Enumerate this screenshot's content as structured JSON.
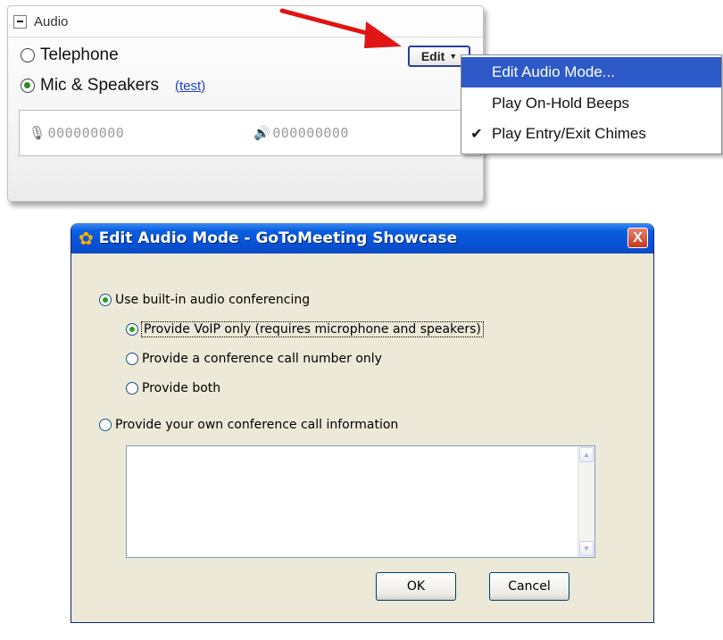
{
  "audio_panel": {
    "title": "Audio",
    "options": [
      {
        "label": "Telephone",
        "selected": false
      },
      {
        "label": "Mic & Speakers",
        "selected": true
      }
    ],
    "test_link": "(test)",
    "edit_button": "Edit",
    "mic_meter": "000000000",
    "speaker_meter": "000000000"
  },
  "menu": {
    "items": [
      {
        "label": "Edit Audio Mode...",
        "checked": false,
        "highlighted": true
      },
      {
        "label": "Play On-Hold Beeps",
        "checked": false,
        "highlighted": false
      },
      {
        "label": "Play Entry/Exit Chimes",
        "checked": true,
        "highlighted": false
      }
    ]
  },
  "dialog": {
    "title": "Edit Audio Mode - GoToMeeting Showcase",
    "close_label": "X",
    "option_builtin": "Use built-in audio conferencing",
    "sub_voip": "Provide VoIP only (requires microphone and speakers)",
    "sub_conference": "Provide a conference call number only",
    "sub_both": "Provide both",
    "option_own": "Provide your own conference call information",
    "conference_info_value": "",
    "ok_label": "OK",
    "cancel_label": "Cancel"
  },
  "colors": {
    "menu_highlight": "#2e59c8",
    "titlebar": "#0754d8",
    "link": "#1b3fd4",
    "arrow": "#e01515"
  }
}
